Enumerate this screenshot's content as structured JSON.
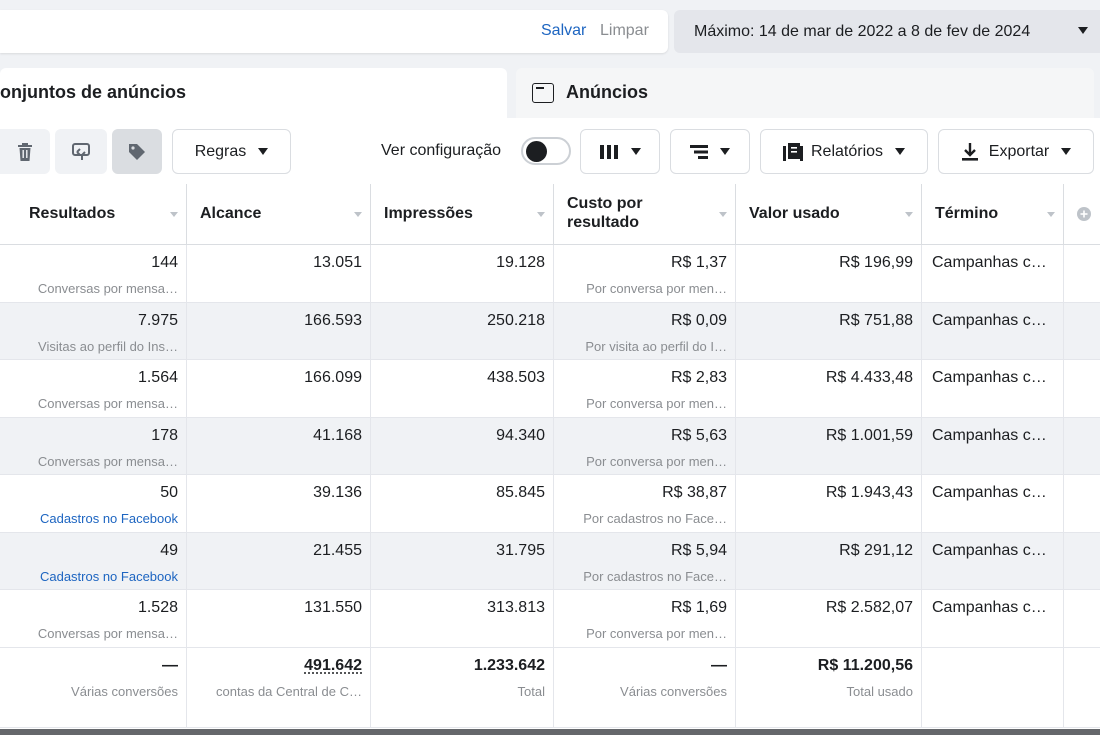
{
  "topbar": {
    "save_label": "Salvar",
    "clear_label": "Limpar"
  },
  "date_range": {
    "label": "Máximo: 14 de mar de 2022 a 8 de fev de 2024"
  },
  "tabs": [
    {
      "label": "onjuntos de anúncios"
    },
    {
      "label": "Anúncios"
    }
  ],
  "toolbar": {
    "rules_label": "Regras",
    "ver_configuracao_label": "Ver configuração",
    "reports_label": "Relatórios",
    "export_label": "Exportar"
  },
  "table": {
    "headers": [
      {
        "label": "Resultados"
      },
      {
        "label": "Alcance"
      },
      {
        "label": "Impressões"
      },
      {
        "label": "Custo por resultado"
      },
      {
        "label": "Valor usado"
      },
      {
        "label": "Término"
      }
    ],
    "rows": [
      {
        "results": "144",
        "results_sub": "Conversas por mensa…",
        "reach": "13.051",
        "impressions": "19.128",
        "cost": "R$ 1,37",
        "cost_sub": "Por conversa por men…",
        "spent": "R$ 196,99",
        "end": "Campanhas c…"
      },
      {
        "results": "7.975",
        "results_sub": "Visitas ao perfil do Ins…",
        "reach": "166.593",
        "impressions": "250.218",
        "cost": "R$ 0,09",
        "cost_sub": "Por visita ao perfil do I…",
        "spent": "R$ 751,88",
        "end": "Campanhas c…"
      },
      {
        "results": "1.564",
        "results_sub": "Conversas por mensa…",
        "reach": "166.099",
        "impressions": "438.503",
        "cost": "R$ 2,83",
        "cost_sub": "Por conversa por men…",
        "spent": "R$ 4.433,48",
        "end": "Campanhas c…"
      },
      {
        "results": "178",
        "results_sub": "Conversas por mensa…",
        "reach": "41.168",
        "impressions": "94.340",
        "cost": "R$ 5,63",
        "cost_sub": "Por conversa por men…",
        "spent": "R$ 1.001,59",
        "end": "Campanhas c…"
      },
      {
        "results": "50",
        "results_sub": "Cadastros no Facebook",
        "reach": "39.136",
        "impressions": "85.845",
        "cost": "R$ 38,87",
        "cost_sub": "Por cadastros no Face…",
        "spent": "R$ 1.943,43",
        "end": "Campanhas c…"
      },
      {
        "results": "49",
        "results_sub": "Cadastros no Facebook",
        "reach": "21.455",
        "impressions": "31.795",
        "cost": "R$ 5,94",
        "cost_sub": "Por cadastros no Face…",
        "spent": "R$ 291,12",
        "end": "Campanhas c…"
      },
      {
        "results": "1.528",
        "results_sub": "Conversas por mensa…",
        "reach": "131.550",
        "impressions": "313.813",
        "cost": "R$ 1,69",
        "cost_sub": "Por conversa por men…",
        "spent": "R$ 2.582,07",
        "end": "Campanhas c…"
      }
    ],
    "totals": {
      "results": "—",
      "results_sub": "Várias conversões",
      "reach": "491.642",
      "reach_sub": "contas da Central de C…",
      "impressions": "1.233.642",
      "impressions_sub": "Total",
      "cost": "—",
      "cost_sub": "Várias conversões",
      "spent": "R$ 11.200,56",
      "spent_sub": "Total usado"
    }
  }
}
